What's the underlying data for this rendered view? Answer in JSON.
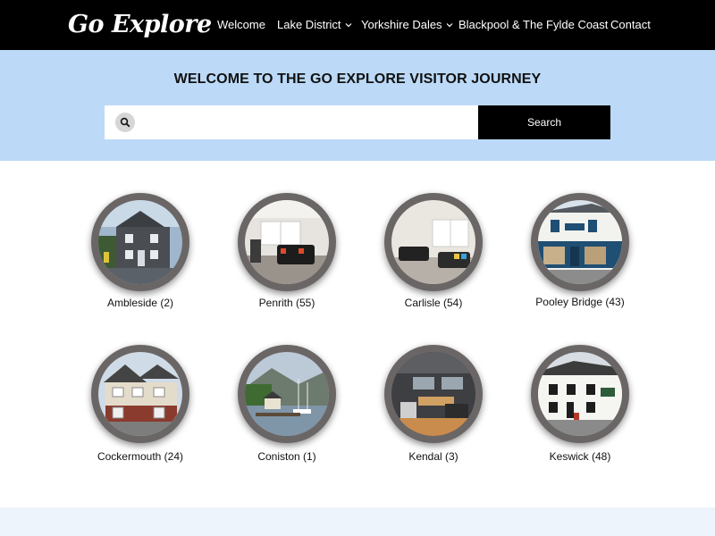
{
  "header": {
    "logo": "Go Explore",
    "nav": [
      {
        "label": "Welcome",
        "dropdown": false
      },
      {
        "label": "Lake District",
        "dropdown": true
      },
      {
        "label": "Yorkshire Dales",
        "dropdown": true
      },
      {
        "label": "Blackpool & The Fylde Coast",
        "dropdown": false
      },
      {
        "label": "Contact",
        "dropdown": false
      }
    ]
  },
  "hero": {
    "title": "WELCOME TO THE GO EXPLORE VISITOR JOURNEY",
    "search_placeholder": "",
    "search_button": "Search"
  },
  "locations": [
    {
      "label": "Ambleside (2)",
      "photo": "stone-house"
    },
    {
      "label": "Penrith (55)",
      "photo": "living-room"
    },
    {
      "label": "Carlisle (54)",
      "photo": "living-room-window"
    },
    {
      "label": "Pooley Bridge (43)",
      "photo": "shop-front"
    },
    {
      "label": "Cockermouth (24)",
      "photo": "brick-house"
    },
    {
      "label": "Coniston (1)",
      "photo": "lake-jetty"
    },
    {
      "label": "Kendal (3)",
      "photo": "motorhome-interior"
    },
    {
      "label": "Keswick (48)",
      "photo": "white-pub"
    }
  ],
  "colors": {
    "nav_bg": "#000000",
    "hero_bg": "#bcdaf7",
    "ring": "#6b6666",
    "footer_band": "#eef4fc"
  }
}
